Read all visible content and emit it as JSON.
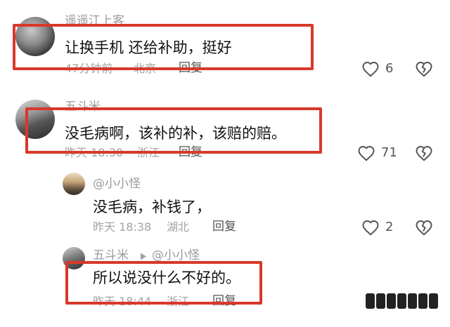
{
  "comments": [
    {
      "username": "遥遥江上客",
      "text": "让换手机 还给补助，挺好",
      "time": "47分钟前",
      "location": "北京",
      "reply_label": "回复",
      "likes": "6"
    },
    {
      "username": "五斗米",
      "text": "没毛病啊，该补的补，该赔的赔。",
      "time": "昨天 18:30",
      "location": "浙江",
      "reply_label": "回复",
      "likes": "71"
    }
  ],
  "replies": [
    {
      "username": "@小小怪",
      "text": "没毛病，补钱了，",
      "time": "昨天 18:38",
      "location": "湖北",
      "reply_label": "回复",
      "likes": "2"
    },
    {
      "username": "五斗米",
      "reply_to": "@小小怪",
      "text": "所以说没什么不好的。",
      "time": "昨天 18:44",
      "location": "浙江",
      "reply_label": "回复"
    }
  ],
  "colors": {
    "highlight": "#d9382a",
    "icon": "#555555"
  }
}
